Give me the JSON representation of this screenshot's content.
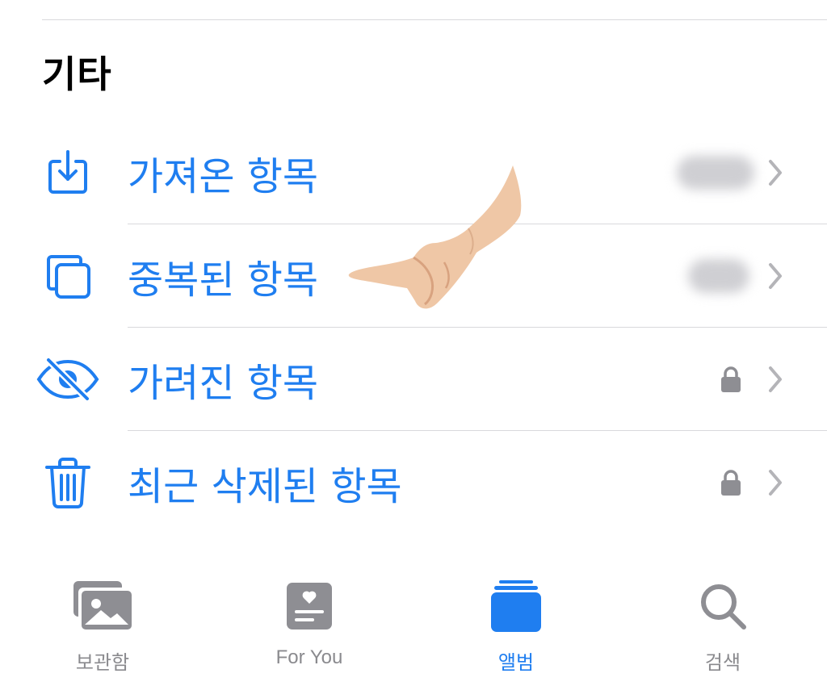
{
  "section": {
    "title": "기타"
  },
  "rows": [
    {
      "label": "가져온 항목",
      "icon": "import-icon",
      "trailing": "blurred-count"
    },
    {
      "label": "중복된 항목",
      "icon": "duplicate-icon",
      "trailing": "blurred-count"
    },
    {
      "label": "가려진 항목",
      "icon": "eye-slash-icon",
      "trailing": "lock-icon"
    },
    {
      "label": "최근 삭제된 항목",
      "icon": "trash-icon",
      "trailing": "lock-icon"
    }
  ],
  "tabbar": {
    "tabs": [
      {
        "label": "보관함",
        "icon": "photos-library-icon",
        "active": false
      },
      {
        "label": "For You",
        "icon": "for-you-icon",
        "active": false
      },
      {
        "label": "앨범",
        "icon": "albums-icon",
        "active": true
      },
      {
        "label": "검색",
        "icon": "search-icon",
        "active": false
      }
    ]
  },
  "colors": {
    "accent": "#1f7ef0",
    "inactive": "#8a8a8e",
    "divider": "#d9d9dc"
  }
}
